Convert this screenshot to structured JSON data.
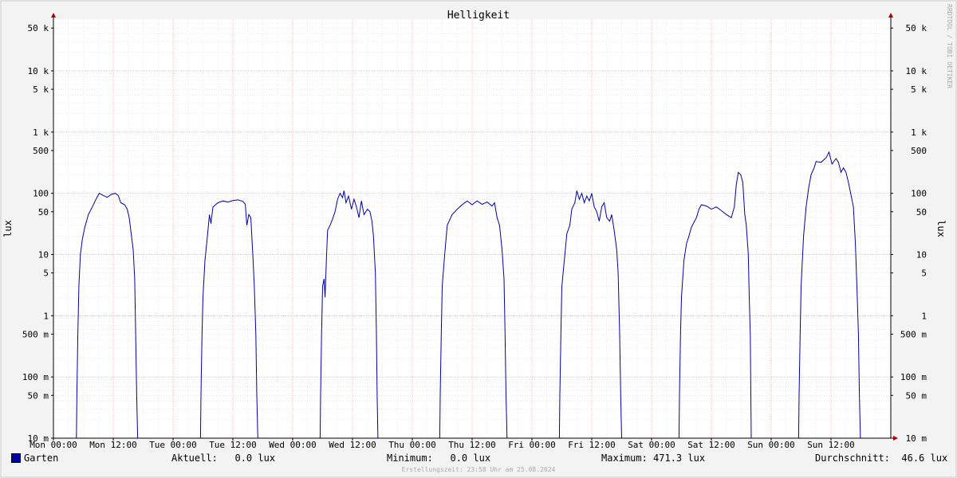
{
  "chart_data": {
    "type": "line",
    "title": "Helligkeit",
    "ylabel": "lux",
    "y_scale": "log",
    "ylim": [
      0.01,
      70000
    ],
    "xlim": [
      0,
      168
    ],
    "grid": true,
    "watermark": "RRDTOOL / TOBI OETIKER",
    "y_ticks": [
      {
        "value": 50000,
        "label": "50 k"
      },
      {
        "value": 10000,
        "label": "10 k"
      },
      {
        "value": 5000,
        "label": "5 k"
      },
      {
        "value": 1000,
        "label": "1 k"
      },
      {
        "value": 500,
        "label": "500"
      },
      {
        "value": 100,
        "label": "100"
      },
      {
        "value": 50,
        "label": "50"
      },
      {
        "value": 10,
        "label": "10"
      },
      {
        "value": 5,
        "label": "5"
      },
      {
        "value": 1,
        "label": "1"
      },
      {
        "value": 0.5,
        "label": "500 m"
      },
      {
        "value": 0.1,
        "label": "100 m"
      },
      {
        "value": 0.05,
        "label": "50 m"
      },
      {
        "value": 0.01,
        "label": "10 m"
      }
    ],
    "x_ticks": [
      {
        "hour": 0,
        "label": "Mon 00:00"
      },
      {
        "hour": 12,
        "label": "Mon 12:00"
      },
      {
        "hour": 24,
        "label": "Tue 00:00"
      },
      {
        "hour": 36,
        "label": "Tue 12:00"
      },
      {
        "hour": 48,
        "label": "Wed 00:00"
      },
      {
        "hour": 60,
        "label": "Wed 12:00"
      },
      {
        "hour": 72,
        "label": "Thu 00:00"
      },
      {
        "hour": 84,
        "label": "Thu 12:00"
      },
      {
        "hour": 96,
        "label": "Fri 00:00"
      },
      {
        "hour": 108,
        "label": "Fri 12:00"
      },
      {
        "hour": 120,
        "label": "Sat 00:00"
      },
      {
        "hour": 132,
        "label": "Sat 12:00"
      },
      {
        "hour": 144,
        "label": "Sun 00:00"
      },
      {
        "hour": 156,
        "label": "Sun 12:00"
      }
    ],
    "series": [
      {
        "name": "Garten",
        "color": "#0000aa",
        "points": [
          [
            4.6,
            0.01
          ],
          [
            4.7,
            0.05
          ],
          [
            4.9,
            0.5
          ],
          [
            5.1,
            3
          ],
          [
            5.4,
            10
          ],
          [
            5.8,
            18
          ],
          [
            6.3,
            28
          ],
          [
            7,
            45
          ],
          [
            7.8,
            60
          ],
          [
            8.6,
            82
          ],
          [
            9.2,
            100
          ],
          [
            10,
            92
          ],
          [
            10.8,
            86
          ],
          [
            11.6,
            96
          ],
          [
            12.4,
            100
          ],
          [
            13,
            92
          ],
          [
            13.5,
            70
          ],
          [
            14.3,
            65
          ],
          [
            14.8,
            55
          ],
          [
            15.2,
            40
          ],
          [
            15.6,
            22
          ],
          [
            16,
            12
          ],
          [
            16.3,
            4
          ],
          [
            16.5,
            0.5
          ],
          [
            16.7,
            0.05
          ],
          [
            16.9,
            0.01
          ],
          [
            29.5,
            0.01
          ],
          [
            29.6,
            0.05
          ],
          [
            29.8,
            0.5
          ],
          [
            30,
            2
          ],
          [
            30.4,
            8
          ],
          [
            30.9,
            20
          ],
          [
            31.3,
            45
          ],
          [
            31.6,
            32
          ],
          [
            32,
            60
          ],
          [
            33,
            70
          ],
          [
            34,
            75
          ],
          [
            35,
            72
          ],
          [
            36,
            76
          ],
          [
            37,
            78
          ],
          [
            38,
            74
          ],
          [
            38.5,
            66
          ],
          [
            38.8,
            30
          ],
          [
            39.2,
            45
          ],
          [
            39.6,
            40
          ],
          [
            40,
            10
          ],
          [
            40.3,
            3
          ],
          [
            40.6,
            0.5
          ],
          [
            40.8,
            0.05
          ],
          [
            41,
            0.01
          ],
          [
            53.5,
            0.01
          ],
          [
            53.6,
            0.05
          ],
          [
            53.8,
            0.5
          ],
          [
            54,
            3
          ],
          [
            54.3,
            4
          ],
          [
            54.5,
            2
          ],
          [
            54.8,
            10
          ],
          [
            55,
            25
          ],
          [
            55.5,
            30
          ],
          [
            56,
            38
          ],
          [
            56.5,
            50
          ],
          [
            57,
            80
          ],
          [
            57.5,
            100
          ],
          [
            58,
            85
          ],
          [
            58.3,
            110
          ],
          [
            58.7,
            70
          ],
          [
            59.2,
            90
          ],
          [
            59.8,
            55
          ],
          [
            60.3,
            80
          ],
          [
            60.8,
            60
          ],
          [
            61.3,
            40
          ],
          [
            61.8,
            75
          ],
          [
            62.3,
            45
          ],
          [
            63,
            55
          ],
          [
            63.5,
            50
          ],
          [
            63.9,
            35
          ],
          [
            64.2,
            20
          ],
          [
            64.6,
            5
          ],
          [
            64.8,
            0.5
          ],
          [
            64.95,
            0.05
          ],
          [
            65.1,
            0.01
          ],
          [
            77.5,
            0.01
          ],
          [
            77.6,
            0.05
          ],
          [
            77.8,
            0.5
          ],
          [
            78,
            3
          ],
          [
            78.5,
            10
          ],
          [
            79,
            30
          ],
          [
            80,
            45
          ],
          [
            81,
            55
          ],
          [
            82,
            65
          ],
          [
            83,
            75
          ],
          [
            84,
            65
          ],
          [
            85,
            75
          ],
          [
            86,
            66
          ],
          [
            87,
            72
          ],
          [
            88,
            62
          ],
          [
            88.5,
            70
          ],
          [
            89,
            40
          ],
          [
            89.5,
            30
          ],
          [
            90,
            12
          ],
          [
            90.4,
            4
          ],
          [
            90.6,
            0.5
          ],
          [
            90.8,
            0.05
          ],
          [
            91,
            0.01
          ],
          [
            101.5,
            0.01
          ],
          [
            101.6,
            0.05
          ],
          [
            101.8,
            0.5
          ],
          [
            102,
            3
          ],
          [
            102.5,
            8
          ],
          [
            103,
            22
          ],
          [
            103.6,
            30
          ],
          [
            104,
            55
          ],
          [
            104.6,
            70
          ],
          [
            105,
            110
          ],
          [
            105.5,
            80
          ],
          [
            106,
            100
          ],
          [
            106.5,
            70
          ],
          [
            107,
            90
          ],
          [
            107.5,
            75
          ],
          [
            108,
            100
          ],
          [
            108.5,
            60
          ],
          [
            109,
            50
          ],
          [
            109.5,
            35
          ],
          [
            110,
            60
          ],
          [
            110.5,
            70
          ],
          [
            111,
            40
          ],
          [
            111.6,
            35
          ],
          [
            112,
            45
          ],
          [
            112.5,
            25
          ],
          [
            113,
            12
          ],
          [
            113.3,
            5
          ],
          [
            113.6,
            0.5
          ],
          [
            113.8,
            0.05
          ],
          [
            114,
            0.01
          ],
          [
            125.5,
            0.01
          ],
          [
            125.6,
            0.05
          ],
          [
            125.8,
            0.5
          ],
          [
            126,
            2
          ],
          [
            126.5,
            8
          ],
          [
            127,
            15
          ],
          [
            127.5,
            20
          ],
          [
            128,
            28
          ],
          [
            129,
            40
          ],
          [
            129.5,
            55
          ],
          [
            130,
            65
          ],
          [
            131,
            62
          ],
          [
            132,
            55
          ],
          [
            133,
            60
          ],
          [
            134,
            52
          ],
          [
            135,
            45
          ],
          [
            136,
            40
          ],
          [
            136.6,
            60
          ],
          [
            137,
            140
          ],
          [
            137.4,
            220
          ],
          [
            137.9,
            200
          ],
          [
            138.3,
            150
          ],
          [
            138.7,
            45
          ],
          [
            139,
            30
          ],
          [
            139.4,
            10
          ],
          [
            139.6,
            2
          ],
          [
            139.8,
            0.5
          ],
          [
            140,
            0.01
          ],
          [
            149.5,
            0.01
          ],
          [
            149.6,
            0.05
          ],
          [
            149.8,
            0.5
          ],
          [
            150,
            3
          ],
          [
            150.5,
            20
          ],
          [
            151,
            60
          ],
          [
            151.5,
            120
          ],
          [
            152,
            200
          ],
          [
            152.6,
            260
          ],
          [
            153,
            330
          ],
          [
            154,
            320
          ],
          [
            155,
            380
          ],
          [
            155.6,
            471.3
          ],
          [
            156.2,
            300
          ],
          [
            157,
            370
          ],
          [
            157.5,
            320
          ],
          [
            158,
            220
          ],
          [
            158.5,
            260
          ],
          [
            159,
            220
          ],
          [
            159.5,
            150
          ],
          [
            160,
            95
          ],
          [
            160.5,
            60
          ],
          [
            160.9,
            15
          ],
          [
            161.2,
            3
          ],
          [
            161.5,
            0.5
          ],
          [
            161.7,
            0.05
          ],
          [
            161.9,
            0.01
          ]
        ]
      }
    ]
  },
  "legend": {
    "series_label": "Garten",
    "current": "Aktuell:   0.0 lux",
    "minimum": "Minimum:   0.0 lux",
    "maximum": "Maximum: 471.3 lux",
    "average": "Durchschnitt:  46.6 lux"
  },
  "footer": "Erstellungszeit: 23:58 Uhr am 25.08.2024"
}
